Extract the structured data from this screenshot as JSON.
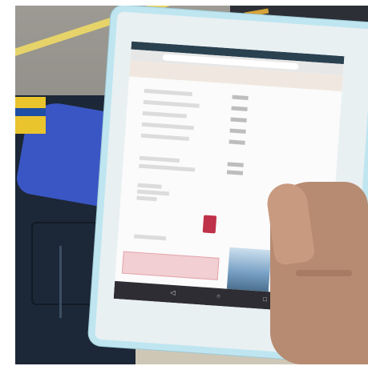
{
  "image": {
    "kind": "photo-of-tablet-held-outdoors",
    "tablet_screen_text_legible": false
  },
  "colors": {
    "tablet_frame": "#bfe6f0",
    "officer_jacket": "#3a56c4",
    "uniform_dark": "#1c2737",
    "lane_line": "#e6d36a",
    "asphalt": "#8e8c84",
    "screen_status_bar": "#2a4150",
    "action_button": "#c0324a",
    "alert_box": "#f1cfd2"
  },
  "icons": {
    "back": "triangle-left-icon",
    "home": "circle-icon",
    "recents": "square-icon"
  }
}
